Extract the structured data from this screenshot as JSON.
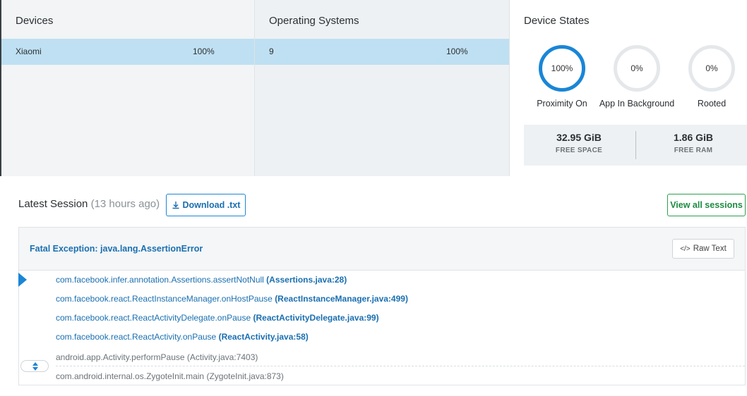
{
  "devices": {
    "title": "Devices",
    "selected": {
      "name": "Xiaomi",
      "percent": "100%"
    }
  },
  "operating_systems": {
    "title": "Operating Systems",
    "selected": {
      "name": "9",
      "percent": "100%"
    }
  },
  "device_states": {
    "title": "Device States",
    "gauges": [
      {
        "value": "100%",
        "label": "Proximity On",
        "fraction": 1.0
      },
      {
        "value": "0%",
        "label": "App In Background",
        "fraction": 0.0
      },
      {
        "value": "0%",
        "label": "Rooted",
        "fraction": 0.0
      }
    ],
    "free_space": {
      "value": "32.95 GiB",
      "label": "FREE SPACE"
    },
    "free_ram": {
      "value": "1.86 GiB",
      "label": "FREE RAM"
    }
  },
  "session": {
    "title": "Latest Session",
    "ago": "(13 hours ago)",
    "download_label": "Download .txt",
    "view_all_label": "View all sessions"
  },
  "exception": {
    "title": "Fatal Exception: java.lang.AssertionError",
    "raw_text_label": "Raw Text",
    "frames": [
      {
        "method": "com.facebook.infer.annotation.Assertions.assertNotNull",
        "location": "(Assertions.java:28)",
        "kind": "app"
      },
      {
        "method": "com.facebook.react.ReactInstanceManager.onHostPause",
        "location": "(ReactInstanceManager.java:499)",
        "kind": "app"
      },
      {
        "method": "com.facebook.react.ReactActivityDelegate.onPause",
        "location": "(ReactActivityDelegate.java:99)",
        "kind": "app"
      },
      {
        "method": "com.facebook.react.ReactActivity.onPause",
        "location": "(ReactActivity.java:58)",
        "kind": "app"
      },
      {
        "method": "android.app.Activity.performPause",
        "location": "(Activity.java:7403)",
        "kind": "system"
      },
      {
        "method": "com.android.internal.os.ZygoteInit.main",
        "location": "(ZygoteInit.java:873)",
        "kind": "system"
      }
    ]
  },
  "colors": {
    "accent": "#1a86d6",
    "selected_row": "#bfe0f2",
    "success": "#2aa14f"
  }
}
